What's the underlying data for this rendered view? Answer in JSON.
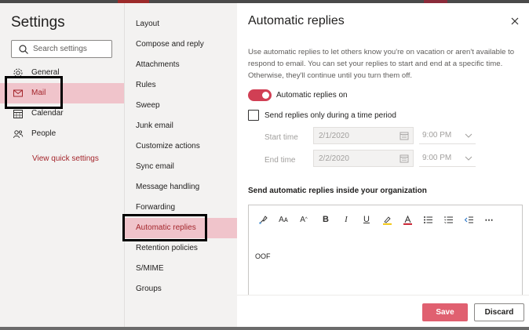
{
  "settings": {
    "title": "Settings",
    "search_placeholder": "Search settings",
    "categories": [
      {
        "label": "General",
        "icon": "gear-icon"
      },
      {
        "label": "Mail",
        "icon": "mail-icon",
        "selected": true
      },
      {
        "label": "Calendar",
        "icon": "calendar-icon"
      },
      {
        "label": "People",
        "icon": "people-icon"
      }
    ],
    "quick_settings_link": "View quick settings"
  },
  "mail_nav": {
    "items": [
      {
        "label": "Layout"
      },
      {
        "label": "Compose and reply"
      },
      {
        "label": "Attachments"
      },
      {
        "label": "Rules"
      },
      {
        "label": "Sweep"
      },
      {
        "label": "Junk email"
      },
      {
        "label": "Customize actions"
      },
      {
        "label": "Sync email"
      },
      {
        "label": "Message handling"
      },
      {
        "label": "Forwarding"
      },
      {
        "label": "Automatic replies",
        "selected": true
      },
      {
        "label": "Retention policies"
      },
      {
        "label": "S/MIME"
      },
      {
        "label": "Groups"
      }
    ]
  },
  "panel": {
    "title": "Automatic replies",
    "description": "Use automatic replies to let others know you're on vacation or aren't available to respond to email. You can set your replies to start and end at a specific time. Otherwise, they'll continue until you turn them off.",
    "toggle_label": "Automatic replies on",
    "toggle_on": true,
    "time_period_label": "Send replies only during a time period",
    "time_period_checked": false,
    "start_label": "Start time",
    "start_date": "2/1/2020",
    "start_time": "9:00 PM",
    "end_label": "End time",
    "end_date": "2/2/2020",
    "end_time": "9:00 PM",
    "inside_org_title": "Send automatic replies inside your organization",
    "message_body": "OOF",
    "toolbar_icons": [
      "format-painter-icon",
      "font-size-icon",
      "font-size-increase-icon",
      "bold-icon",
      "italic-icon",
      "underline-icon",
      "highlight-icon",
      "font-color-icon",
      "bullets-icon",
      "numbering-icon",
      "decrease-indent-icon",
      "more-options-icon"
    ],
    "save_label": "Save",
    "discard_label": "Discard"
  },
  "colors": {
    "accent": "#a4262c",
    "selected_bg": "#f0c4cb",
    "save_button": "#e06070",
    "toggle": "#d13f54"
  }
}
